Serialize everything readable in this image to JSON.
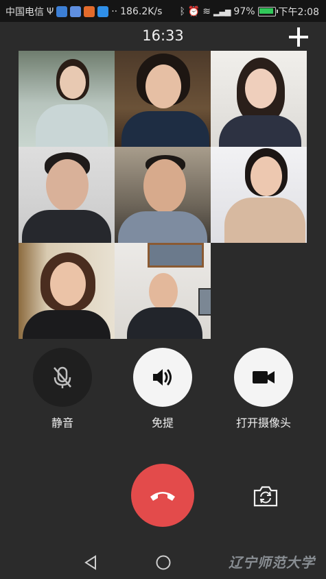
{
  "status_bar": {
    "carrier": "中国电信",
    "speed": "186.2K/s",
    "battery": "97%",
    "time": "下午2:08"
  },
  "call": {
    "duration": "16:33",
    "add_icon": "plus-icon"
  },
  "participants": [
    {
      "id": 1,
      "tone": "#cfd8d2"
    },
    {
      "id": 2,
      "tone": "#4a3b2e"
    },
    {
      "id": 3,
      "tone": "#e8e6e2"
    },
    {
      "id": 4,
      "tone": "#d9d9d9"
    },
    {
      "id": 5,
      "tone": "#6b6256"
    },
    {
      "id": 6,
      "tone": "#e9e9ee"
    },
    {
      "id": 7,
      "tone": "#cfc3b0"
    },
    {
      "id": 8,
      "tone": "#e7e5e2"
    }
  ],
  "controls": {
    "mute_label": "静音",
    "speaker_label": "免提",
    "camera_label": "打开摄像头"
  },
  "watermark": "辽宁师范大学",
  "colors": {
    "background": "#2b2b2b",
    "hangup": "#e34b4b",
    "button_light": "#f4f4f4",
    "button_dark": "#1f1f1f"
  }
}
